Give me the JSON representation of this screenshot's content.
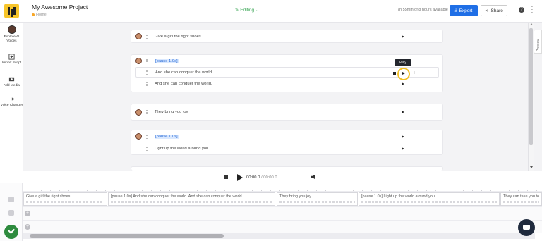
{
  "header": {
    "project_title": "My Awesome Project",
    "breadcrumb": "Home",
    "mode_label": "Editing",
    "usage_text": "7h 55min of 8 hours available",
    "export_label": "Export",
    "share_label": "Share",
    "help_label": "?"
  },
  "sidebar": {
    "items": [
      {
        "label": "Explore AI Voices",
        "icon": "avatar-icon"
      },
      {
        "label": "Import Script",
        "icon": "import-icon"
      },
      {
        "label": "Add Media",
        "icon": "media-icon"
      },
      {
        "label": "Voice Changer",
        "icon": "voice-changer-icon"
      }
    ]
  },
  "script": {
    "blocks": [
      {
        "rows": [
          {
            "text": "Give a girl the right shoes."
          }
        ]
      },
      {
        "rows": [
          {
            "tag": "[pause 1.0s]"
          },
          {
            "text": "And she can conquer the world."
          },
          {
            "text": "And she can conquer the world."
          }
        ]
      },
      {
        "rows": [
          {
            "text": "They bring you joy."
          }
        ]
      },
      {
        "rows": [
          {
            "tag": "[pause 1.0s]"
          },
          {
            "text": "Light up the world around you."
          }
        ]
      }
    ],
    "tooltip": "Play"
  },
  "preview_tab_label": "Preview",
  "player": {
    "current_time": "00:00.0",
    "separator": "/",
    "total_time": "00:00.0"
  },
  "timeline": {
    "clips": [
      "Give a girl the right shoes.",
      "[pause 1.0s] And she can conquer the world. And she can conquer the world.",
      "They bring you joy.",
      "[pause 1.0s] Light up the world around you.",
      "They can take you to"
    ]
  },
  "colors": {
    "accent": "#1f6fe6",
    "logo": "#f7c52a",
    "editing": "#3aa655",
    "highlight_ring": "#f2c026",
    "playhead": "#e63232",
    "done": "#2e8b3e"
  }
}
